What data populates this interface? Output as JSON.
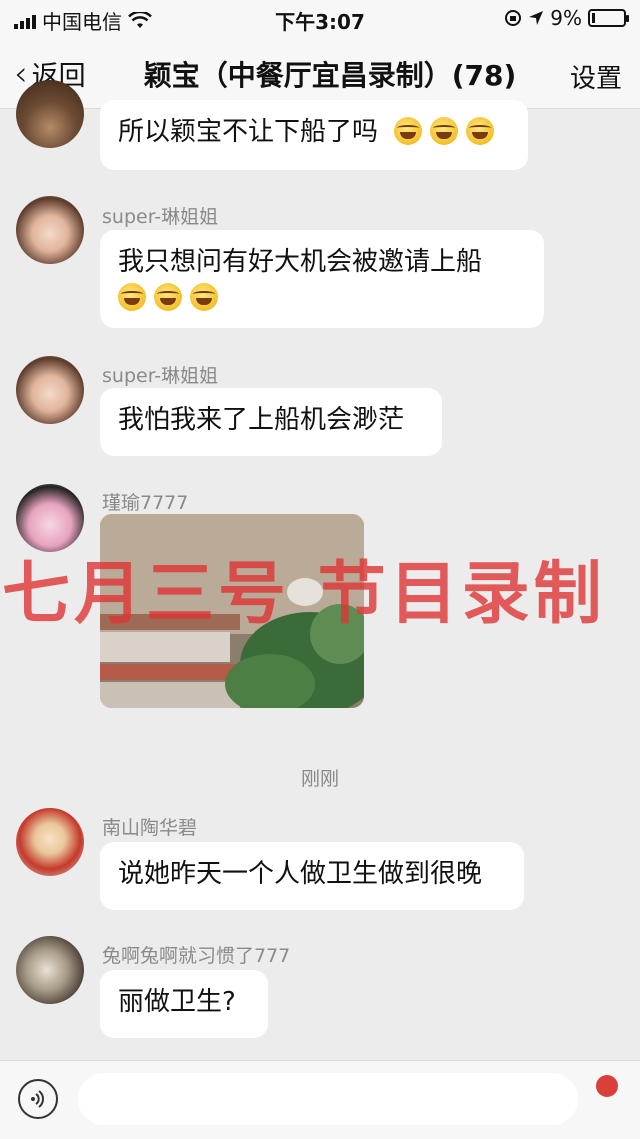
{
  "status_bar": {
    "carrier": "中国电信",
    "time": "下午3:07",
    "battery_text": "9%",
    "battery_level": 0.09,
    "icons": [
      "signal-icon",
      "wifi-icon",
      "orientation-lock-icon",
      "location-arrow-icon",
      "battery-icon"
    ]
  },
  "nav": {
    "back_label": "返回",
    "title": "颖宝（中餐厅宜昌录制）(78)",
    "settings_label": "设置"
  },
  "messages": [
    {
      "sender": "",
      "text": "所以颖宝不让下船了吗",
      "emoji_count": 3
    },
    {
      "sender": "super-琳姐姐",
      "text": "我只想问有好大机会被邀请上船",
      "emoji_count": 3
    },
    {
      "sender": "super-琳姐姐",
      "text": "我怕我来了上船机会渺茫",
      "emoji_count": 0
    },
    {
      "sender": "瑾瑜7777",
      "text": "",
      "image": "photo-message"
    },
    {
      "sender": "南山陶华碧",
      "text": "说她昨天一个人做卫生做到很晚",
      "emoji_count": 0
    },
    {
      "sender": "兔啊兔啊就习惯了777",
      "text": "丽做卫生?",
      "emoji_count": 0
    }
  ],
  "time_divider": "刚刚",
  "watermark": "七月三号 节目录制",
  "input": {
    "placeholder": ""
  },
  "colors": {
    "bubble": "#ffffff",
    "background": "#ececec",
    "watermark": "#de3434"
  }
}
